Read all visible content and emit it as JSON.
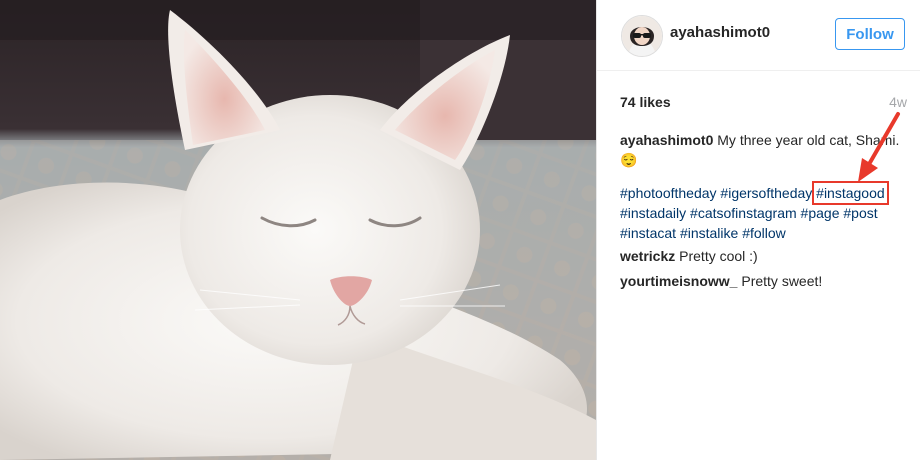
{
  "post": {
    "username": "ayahashimot0",
    "follow_label": "Follow",
    "likes": "74 likes",
    "age": "4w",
    "caption_user": "ayahashimot0",
    "caption_text": " My three year old cat, Shami. 😌",
    "hashtags": [
      "#photooftheday",
      "#igersoftheday",
      "#instagood",
      "#instadaily",
      "#catsofinstagram",
      "#page",
      "#post",
      "#instacat",
      "#instalike",
      "#follow"
    ],
    "highlighted_hashtag": "#instagood",
    "comments": [
      {
        "user": "wetrickz",
        "text": " Pretty cool :)"
      },
      {
        "user": "yourtimeisnoww_",
        "text": " Pretty sweet!"
      }
    ]
  },
  "colors": {
    "link": "#003569",
    "accent": "#3897f0",
    "annotation": "#e8392b"
  },
  "icons": {
    "annotation_arrow": "arrow-icon"
  }
}
